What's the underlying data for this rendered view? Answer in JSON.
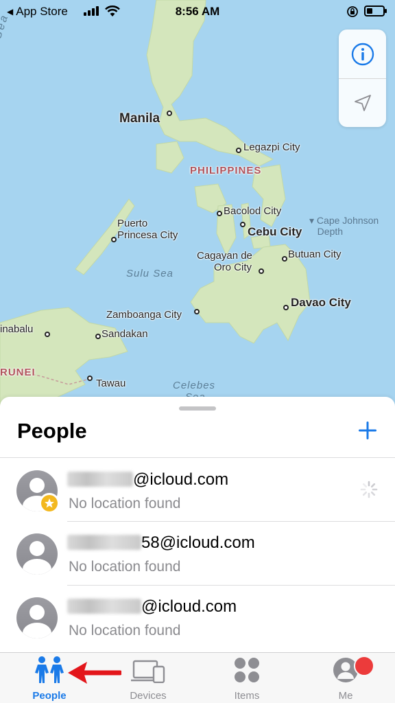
{
  "status_bar": {
    "back_label": "App Store",
    "time": "8:56 AM",
    "battery_level": 0.35
  },
  "map": {
    "labels": {
      "manila": "Manila",
      "legazpi": "Legazpi City",
      "philippines": "PHILIPPINES",
      "bacolod": "Bacolod City",
      "cebu": "Cebu City",
      "cape_johnson": "Cape Johnson",
      "cape_johnson_2": "Depth",
      "puerto": "Puerto",
      "puerto_2": "Princesa City",
      "cagayan": "Cagayan de",
      "cagayan_2": "Oro City",
      "butuan": "Butuan City",
      "sulu_sea": "Sulu Sea",
      "davao": "Davao City",
      "zamboanga": "Zamboanga City",
      "kinabalu": "inabalu",
      "sandakan": "Sandakan",
      "brunei": "RUNEI",
      "tawau": "Tawau",
      "celebes": "Celebes",
      "celebes_2": "Sea",
      "south_china_sea": "th China Sea"
    },
    "controls": [
      "info-icon",
      "location-arrow-icon"
    ]
  },
  "sheet": {
    "title": "People",
    "add_icon": "plus-icon",
    "people": [
      {
        "name_visible": "@icloud.com",
        "status": "No location found",
        "favorite": true,
        "loading": true
      },
      {
        "name_visible": "58@icloud.com",
        "status": "No location found",
        "favorite": false,
        "loading": false
      },
      {
        "name_visible": "@icloud.com",
        "status": "No location found",
        "favorite": false,
        "loading": false
      }
    ]
  },
  "tab_bar": {
    "tabs": [
      {
        "label": "People",
        "icon": "people-icon",
        "active": true
      },
      {
        "label": "Devices",
        "icon": "devices-icon",
        "active": false
      },
      {
        "label": "Items",
        "icon": "items-icon",
        "active": false
      },
      {
        "label": "Me",
        "icon": "me-icon",
        "active": false
      }
    ]
  },
  "colors": {
    "accent": "#1a7ae8",
    "notification": "#ec3b3b",
    "favorite_star": "#f3b81f",
    "annotation_arrow": "#e3161b"
  }
}
